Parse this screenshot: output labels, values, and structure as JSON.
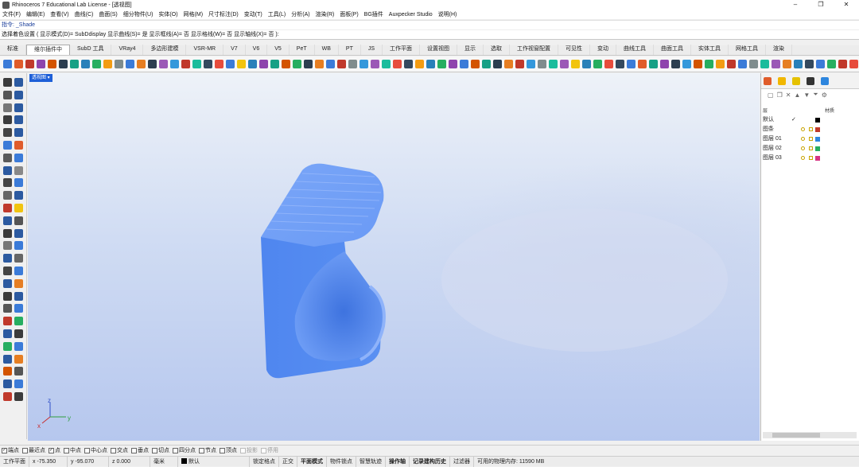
{
  "window": {
    "title": "Rhinoceros 7 Educational Lab License - [透视图]",
    "controls": [
      "–",
      "❐",
      "✕"
    ]
  },
  "menu": [
    "文件(F)",
    "编辑(E)",
    "查看(V)",
    "曲线(C)",
    "曲面(S)",
    "细分物件(U)",
    "实体(O)",
    "网格(M)",
    "尺寸标注(D)",
    "变动(T)",
    "工具(L)",
    "分析(A)",
    "渲染(R)",
    "面板(P)",
    "BG插件",
    "Auxpecker Studio",
    "说明(H)"
  ],
  "command": {
    "history": "指令: _Shade",
    "prompt": "选择着色设置 ( 显示模式(D)= SubDdisplay  显示曲线(S)= 是  显示框线(A)= 否  显示格线(W)= 否  显示轴线(X)= 否 ):"
  },
  "tabs": [
    "标准",
    "维尔插件中",
    "SubD 工具",
    "VRay4",
    "多边形建模",
    "VSR-MR",
    "V7",
    "V6",
    "V5",
    "PeT",
    "WB",
    "PT",
    "JS",
    "工作平面",
    "设置视图",
    "显示",
    "选取",
    "工作视窗配置",
    "可见性",
    "变动",
    "曲线工具",
    "曲面工具",
    "实体工具",
    "网格工具",
    "渲染"
  ],
  "active_tab_index": 1,
  "toolbar_icon_colors": [
    "#3b7bd8",
    "#e05c2a",
    "#c0392b",
    "#8e44ad",
    "#d35400",
    "#2c3e50",
    "#16a085",
    "#2980b9",
    "#27ae60",
    "#f39c12",
    "#7f8c8d",
    "#3b7bd8",
    "#e67e22",
    "#2c3e50",
    "#9b59b6",
    "#3498db",
    "#c0392b",
    "#1abc9c",
    "#34495e",
    "#e74c3c",
    "#3b7bd8",
    "#f1c40f",
    "#2980b9",
    "#8e44ad",
    "#16a085",
    "#d35400",
    "#27ae60",
    "#2c3e50",
    "#e67e22",
    "#3b7bd8",
    "#c0392b",
    "#7f8c8d",
    "#3498db",
    "#9b59b6",
    "#1abc9c",
    "#e74c3c",
    "#34495e",
    "#f39c12",
    "#2980b9",
    "#27ae60",
    "#8e44ad",
    "#3b7bd8",
    "#d35400",
    "#16a085",
    "#2c3e50",
    "#e67e22",
    "#c0392b",
    "#3498db",
    "#7f8c8d",
    "#1abc9c",
    "#9b59b6",
    "#f1c40f",
    "#2980b9",
    "#27ae60",
    "#e74c3c",
    "#34495e",
    "#3b7bd8",
    "#e05c2a",
    "#16a085",
    "#8e44ad",
    "#2c3e50",
    "#3498db",
    "#d35400",
    "#27ae60",
    "#f39c12",
    "#c0392b",
    "#3b7bd8",
    "#7f8c8d",
    "#1abc9c",
    "#9b59b6",
    "#e67e22",
    "#2980b9",
    "#34495e",
    "#3b7bd8",
    "#27ae60",
    "#c0392b",
    "#e74c3c",
    "#2c3e50",
    "#3498db",
    "#f39c12",
    "#16a085",
    "#8e44ad"
  ],
  "viewport": {
    "label": "透视图",
    "axis_x": "x",
    "axis_y": "y",
    "axis_z": "z"
  },
  "layers_panel": {
    "header_name": "层",
    "header_material": "材质",
    "rows": [
      {
        "name": "默认",
        "check": "✓",
        "color": "#000000",
        "show_icons": false
      },
      {
        "name": "图条",
        "check": "",
        "color": "#c0392b",
        "show_icons": true
      },
      {
        "name": "图层 01",
        "check": "",
        "color": "#2e86de",
        "show_icons": true
      },
      {
        "name": "图层 02",
        "check": "",
        "color": "#27ae60",
        "show_icons": true
      },
      {
        "name": "图层 03",
        "check": "",
        "color": "#d63384",
        "show_icons": true
      }
    ]
  },
  "osnaps": [
    {
      "label": "端点",
      "checked": true,
      "disabled": false
    },
    {
      "label": "最近点",
      "checked": false,
      "disabled": false
    },
    {
      "label": "点",
      "checked": true,
      "disabled": false
    },
    {
      "label": "中点",
      "checked": false,
      "disabled": false
    },
    {
      "label": "中心点",
      "checked": false,
      "disabled": false
    },
    {
      "label": "交点",
      "checked": false,
      "disabled": false
    },
    {
      "label": "垂点",
      "checked": false,
      "disabled": false
    },
    {
      "label": "切点",
      "checked": false,
      "disabled": false
    },
    {
      "label": "四分点",
      "checked": false,
      "disabled": false
    },
    {
      "label": "节点",
      "checked": false,
      "disabled": false
    },
    {
      "label": "顶点",
      "checked": false,
      "disabled": false
    },
    {
      "label": "投影",
      "checked": false,
      "disabled": true
    },
    {
      "label": "停用",
      "checked": false,
      "disabled": true
    }
  ],
  "status": {
    "cplane": "工作平面",
    "x": "x -75.350",
    "y": "y -95.070",
    "z": "z 0.000",
    "unit": "毫米",
    "layer": "默认",
    "toggles": [
      "锁定格点",
      "正交",
      "平面模式",
      "物件锁点",
      "智慧轨迹",
      "操作轴",
      "记录建构历史",
      "过滤器"
    ],
    "bold_toggles": [
      "平面模式",
      "操作轴",
      "记录建构历史"
    ],
    "memory": "可用的物理内存: 11590 MB"
  }
}
